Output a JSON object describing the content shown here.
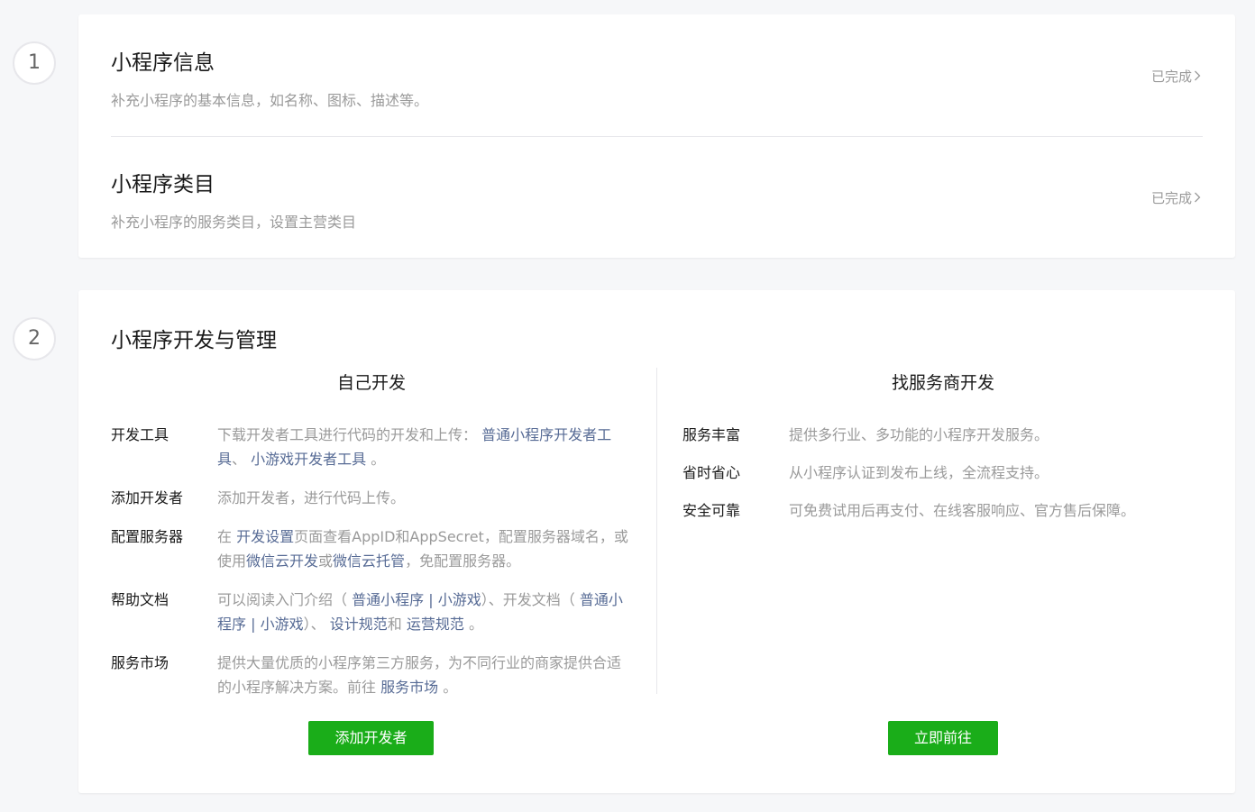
{
  "steps": [
    {
      "number": "1"
    },
    {
      "number": "2"
    }
  ],
  "info_card": {
    "rows": [
      {
        "title": "小程序信息",
        "desc": "补充小程序的基本信息，如名称、图标、描述等。",
        "status": "已完成"
      },
      {
        "title": "小程序类目",
        "desc": "补充小程序的服务类目，设置主营类目",
        "status": "已完成"
      }
    ],
    "chevron_icon": "chevron-right-icon"
  },
  "dev_card": {
    "title": "小程序开发与管理",
    "self_dev": {
      "title": "自己开发",
      "items": [
        {
          "label": "开发工具",
          "parts": [
            "下载开发者工具进行代码的开发和上传：",
            "普通小程序开发者工具",
            "、",
            "小游戏开发者工具",
            "。"
          ]
        },
        {
          "label": "添加开发者",
          "parts": [
            "添加开发者，进行代码上传。"
          ]
        },
        {
          "label": "配置服务器",
          "parts": [
            "在",
            "开发设置",
            "页面查看AppID和AppSecret，配置服务器域名，或使用",
            "微信云开发",
            "或",
            "微信云托管",
            "，免配置服务器。"
          ]
        },
        {
          "label": "帮助文档",
          "parts": [
            "可以阅读入门介绍（",
            "普通小程序",
            "|",
            "小游戏",
            "）、开发文档（",
            "普通小程序",
            "|",
            "小游戏",
            "）、",
            "设计规范",
            "和",
            "运营规范",
            "。"
          ]
        },
        {
          "label": "服务市场",
          "parts": [
            "提供大量优质的小程序第三方服务，为不同行业的商家提供合适的小程序解决方案。前往",
            "服务市场",
            "。"
          ]
        }
      ],
      "button": "添加开发者"
    },
    "provider_dev": {
      "title": "找服务商开发",
      "items": [
        {
          "label": "服务丰富",
          "text": "提供多行业、多功能的小程序开发服务。"
        },
        {
          "label": "省时省心",
          "text": "从小程序认证到发布上线，全流程支持。"
        },
        {
          "label": "安全可靠",
          "text": "可免费试用后再支付、在线客服响应、官方售后保障。"
        }
      ],
      "button": "立即前往"
    }
  }
}
